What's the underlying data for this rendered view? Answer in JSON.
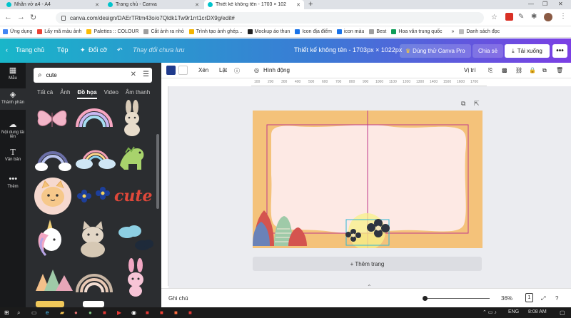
{
  "browser": {
    "tabs": [
      {
        "label": "Nhãn vở a4 - A4",
        "active": false
      },
      {
        "label": "Trang chủ - Canva",
        "active": false
      },
      {
        "label": "Thiết kế không tên - 1703 × 102",
        "active": true
      }
    ],
    "new_tab": "+",
    "url": "canva.com/design/DAErTRtm43o/o7Qldk1Tw9r1rrt1crDX9g/edit#",
    "bookmarks": [
      {
        "label": "Ứng dụng",
        "color": "#4285f4"
      },
      {
        "label": "Lấy mã màu ảnh",
        "color": "#ea4335"
      },
      {
        "label": "Palettes :: COLOUR",
        "color": "#fbbc05"
      },
      {
        "label": "Cắt ảnh ra nhỏ",
        "color": "#9e9e9e"
      },
      {
        "label": "Trình tạo ảnh ghép...",
        "color": "#f4b400"
      },
      {
        "label": "Mockup áo thun",
        "color": "#222222"
      },
      {
        "label": "Icon địa điểm",
        "color": "#1a73e8"
      },
      {
        "label": "icon màu",
        "color": "#1a73e8"
      },
      {
        "label": "Best",
        "color": "#9e9e9e"
      },
      {
        "label": "Hoa văn trung quốc",
        "color": "#0f9d58"
      }
    ],
    "bookmarks_more": "»",
    "reading_list": "Danh sách đọc"
  },
  "header": {
    "home": "Trang chủ",
    "file": "Tệp",
    "resize": "Đổi cỡ",
    "unsaved": "Thay đổi chưa lưu",
    "title": "Thiết kế không tên - 1703px × 1022px",
    "try_pro": "Dùng thử Canva Pro",
    "share": "Chia sẻ",
    "download": "Tải xuống",
    "more": "•••"
  },
  "rail": [
    {
      "label": "Mẫu",
      "icon": "template-icon"
    },
    {
      "label": "Thành phần",
      "icon": "elements-icon"
    },
    {
      "label": "Nội dung tải lên",
      "icon": "upload-icon"
    },
    {
      "label": "Văn bản",
      "icon": "text-icon"
    },
    {
      "label": "Thêm",
      "icon": "more-icon"
    }
  ],
  "panel": {
    "search_value": "cute",
    "categories": [
      "Tất cả",
      "Ảnh",
      "Đồ họa",
      "Video",
      "Âm thanh"
    ],
    "active_category": "Đồ họa",
    "sticker_text": "cute"
  },
  "toolbar": {
    "color_hex": "#1f3a8c",
    "flip_h": "Xén",
    "flip": "Lật",
    "animate": "Hình động",
    "position": "Vị trí"
  },
  "ruler": [
    "100",
    "200",
    "300",
    "400",
    "500",
    "600",
    "700",
    "800",
    "900",
    "1000",
    "1100",
    "1200",
    "1300",
    "1400",
    "1500",
    "1600",
    "1700"
  ],
  "canvas": {
    "add_page": "+ Thêm trang",
    "colors": {
      "background": "#f4c27a",
      "frame": "#fde9e4",
      "guide": "#c0398c"
    }
  },
  "footer": {
    "notes": "Ghi chú",
    "zoom": "36%",
    "page_count": "1"
  },
  "taskbar": {
    "time": "8:08 AM",
    "language": "ENG"
  }
}
